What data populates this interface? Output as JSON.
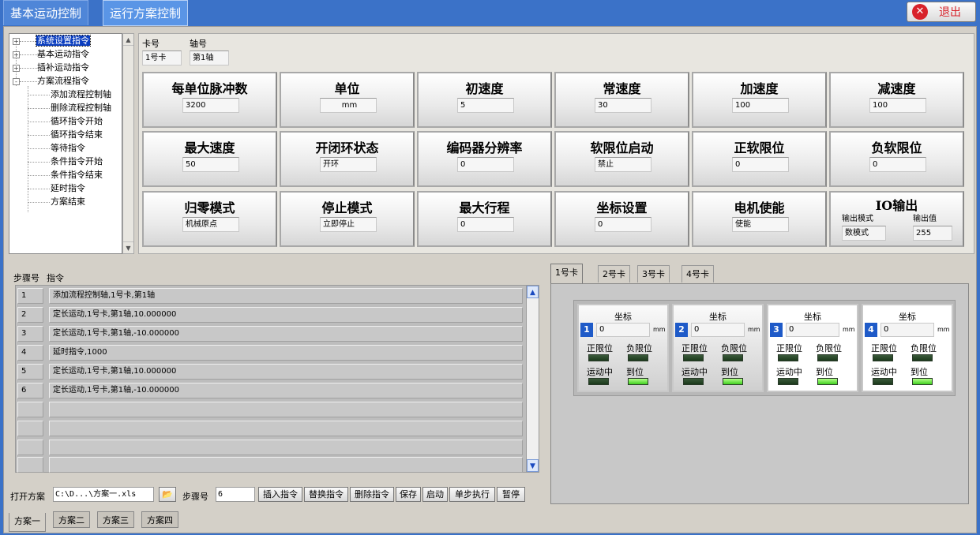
{
  "top_tabs": [
    "基本运动控制",
    "运行方案控制"
  ],
  "exit_label": "退出",
  "tree": {
    "items": [
      {
        "label": "系统设置指令",
        "expander": "+",
        "selected": true
      },
      {
        "label": "基本运动指令",
        "expander": "+"
      },
      {
        "label": "插补运动指令",
        "expander": "+"
      },
      {
        "label": "方案流程指令",
        "expander": "-"
      },
      {
        "label": "添加流程控制轴"
      },
      {
        "label": "删除流程控制轴"
      },
      {
        "label": "循环指令开始"
      },
      {
        "label": "循环指令结束"
      },
      {
        "label": "等待指令"
      },
      {
        "label": "条件指令开始"
      },
      {
        "label": "条件指令结束"
      },
      {
        "label": "延时指令"
      },
      {
        "label": "方案结束"
      }
    ]
  },
  "selector": {
    "card_label": "卡号",
    "card_value": "1号卡",
    "axis_label": "轴号",
    "axis_value": "第1轴"
  },
  "params": [
    {
      "title": "每单位脉冲数",
      "value": "3200"
    },
    {
      "title": "单位",
      "value": "mm"
    },
    {
      "title": "初速度",
      "value": "5"
    },
    {
      "title": "常速度",
      "value": "30"
    },
    {
      "title": "加速度",
      "value": "100"
    },
    {
      "title": "减速度",
      "value": "100"
    },
    {
      "title": "最大速度",
      "value": "50"
    },
    {
      "title": "开闭环状态",
      "value": "开环"
    },
    {
      "title": "编码器分辨率",
      "value": "0"
    },
    {
      "title": "软限位启动",
      "value": "禁止"
    },
    {
      "title": "正软限位",
      "value": "0"
    },
    {
      "title": "负软限位",
      "value": "0"
    },
    {
      "title": "归零模式",
      "value": "机械原点"
    },
    {
      "title": "停止模式",
      "value": "立即停止"
    },
    {
      "title": "最大行程",
      "value": "0"
    },
    {
      "title": "坐标设置",
      "value": "0"
    },
    {
      "title": "电机使能",
      "value": "使能"
    }
  ],
  "io_output": {
    "title": "IO输出",
    "mode_label": "输出模式",
    "mode_value": "数模式",
    "value_label": "输出值",
    "value": "255"
  },
  "steps": {
    "header_step": "步骤号",
    "header_cmd": "指令",
    "rows": [
      {
        "num": "1",
        "cmd": "添加流程控制轴,1号卡,第1轴"
      },
      {
        "num": "2",
        "cmd": "定长运动,1号卡,第1轴,10.000000"
      },
      {
        "num": "3",
        "cmd": "定长运动,1号卡,第1轴,-10.000000"
      },
      {
        "num": "4",
        "cmd": "延时指令,1000"
      },
      {
        "num": "5",
        "cmd": "定长运动,1号卡,第1轴,10.000000"
      },
      {
        "num": "6",
        "cmd": "定长运动,1号卡,第1轴,-10.000000"
      },
      {
        "num": "",
        "cmd": ""
      },
      {
        "num": "",
        "cmd": ""
      },
      {
        "num": "",
        "cmd": ""
      },
      {
        "num": "",
        "cmd": ""
      }
    ]
  },
  "toolbar": {
    "open_label": "打开方案",
    "file_path": "C:\\D...\\方案一.xls",
    "step_label": "步骤号",
    "step_value": "6",
    "buttons": [
      "插入指令",
      "替换指令",
      "删除指令",
      "保存",
      "启动",
      "单步执行",
      "暂停"
    ]
  },
  "plan_tabs": [
    "方案一",
    "方案二",
    "方案三",
    "方案四"
  ],
  "card_tabs": [
    "1号卡",
    "2号卡",
    "3号卡",
    "4号卡"
  ],
  "axes": [
    {
      "num": "1",
      "coord_label": "坐标",
      "coord": "0",
      "unit": "mm",
      "pos_limit": "正限位",
      "neg_limit": "负限位",
      "moving": "运动中",
      "in_pos": "到位"
    },
    {
      "num": "2",
      "coord_label": "坐标",
      "coord": "0",
      "unit": "mm",
      "pos_limit": "正限位",
      "neg_limit": "负限位",
      "moving": "运动中",
      "in_pos": "到位"
    },
    {
      "num": "3",
      "coord_label": "坐标",
      "coord": "0",
      "unit": "mm",
      "pos_limit": "正限位",
      "neg_limit": "负限位",
      "moving": "运动中",
      "in_pos": "到位"
    },
    {
      "num": "4",
      "coord_label": "坐标",
      "coord": "0",
      "unit": "mm",
      "pos_limit": "正限位",
      "neg_limit": "负限位",
      "moving": "运动中",
      "in_pos": "到位"
    }
  ]
}
